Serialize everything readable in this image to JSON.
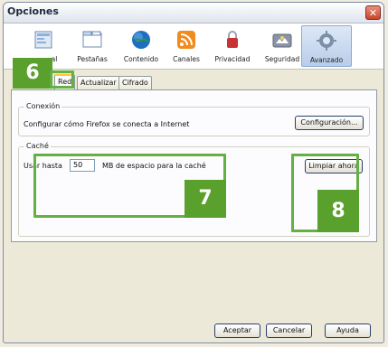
{
  "window": {
    "title": "Opciones",
    "close_glyph": "✕"
  },
  "toolbar": {
    "items": [
      {
        "label": "Principal",
        "visible_label": "al",
        "icon": "general-icon"
      },
      {
        "label": "Pestañas",
        "icon": "tabs-icon"
      },
      {
        "label": "Contenido",
        "icon": "globe-icon"
      },
      {
        "label": "Canales",
        "icon": "feed-icon"
      },
      {
        "label": "Privacidad",
        "icon": "privacy-icon"
      },
      {
        "label": "Seguridad",
        "icon": "security-icon"
      },
      {
        "label": "Avanzado",
        "icon": "gear-icon",
        "selected": true
      }
    ]
  },
  "tabs": [
    {
      "label": "Red",
      "active": true
    },
    {
      "label": "Actualizar"
    },
    {
      "label": "Cifrado"
    }
  ],
  "conexion": {
    "legend": "Conexión",
    "description": "Configurar cómo Firefox se conecta a Internet",
    "button": "Configuración..."
  },
  "cache": {
    "legend": "Caché",
    "use_label": "Usar hasta",
    "value": "50",
    "suffix": "MB de espacio para la caché",
    "clear_button": "Limpiar ahora"
  },
  "footer": {
    "accept": "Aceptar",
    "cancel": "Cancelar",
    "help": "Ayuda"
  },
  "callouts": {
    "six": "6",
    "seven": "7",
    "eight": "8"
  },
  "colors": {
    "callout_green": "#5aa02c",
    "window_bg": "#ece9d8",
    "selected_tab_accent": "#ffc83c"
  }
}
